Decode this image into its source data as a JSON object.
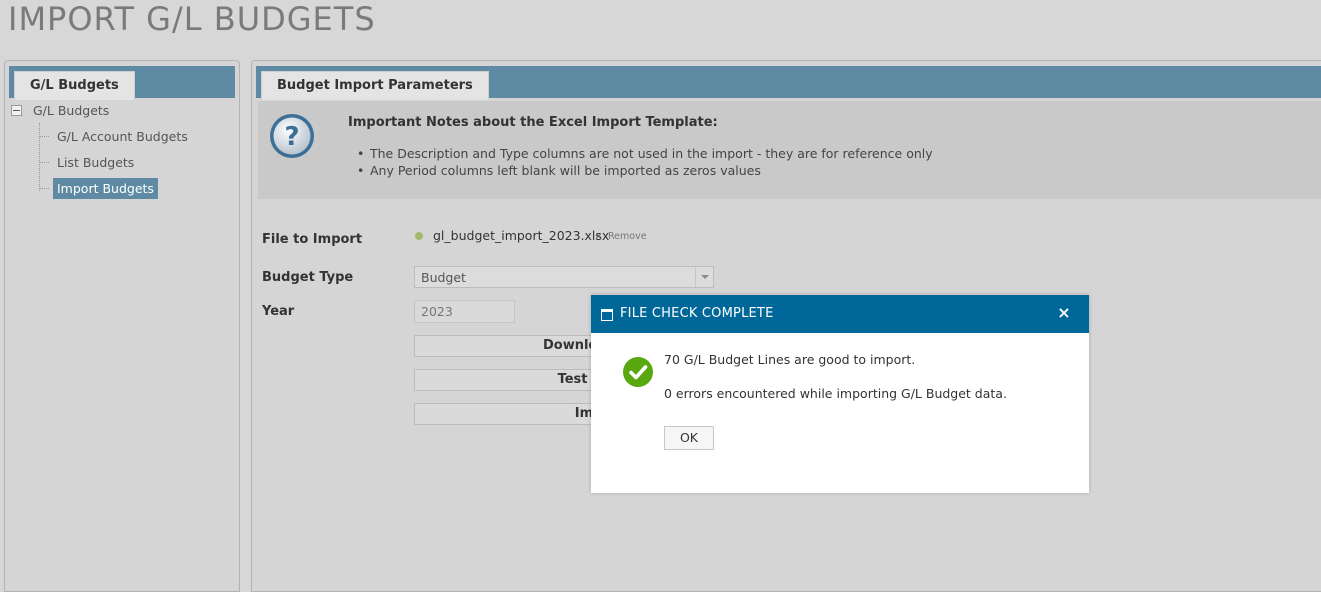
{
  "page": {
    "title": "IMPORT G/L BUDGETS"
  },
  "left_panel": {
    "tab": "G/L Budgets",
    "tree": {
      "root": "G/L Budgets",
      "items": [
        {
          "label": "G/L Account Budgets",
          "selected": false
        },
        {
          "label": "List Budgets",
          "selected": false
        },
        {
          "label": "Import Budgets",
          "selected": true
        }
      ]
    }
  },
  "main_panel": {
    "tab": "Budget Import Parameters",
    "notes": {
      "icon": "help-icon",
      "title": "Important Notes about the Excel Import Template:",
      "items": [
        "The Description and Type columns are not used in the import - they are for reference only",
        "Any Period columns left blank will be imported as zeros values"
      ]
    },
    "form": {
      "file_label": "File to Import",
      "file_name": "gl_budget_import_2023.xlsx",
      "file_remove_x": "×",
      "file_remove": "Remove",
      "budget_type_label": "Budget Type",
      "budget_type_value": "Budget",
      "year_label": "Year",
      "year_value": "2023",
      "buttons": {
        "download": "Download Template",
        "test_import": "Test Import File",
        "import": "Import File"
      }
    }
  },
  "modal": {
    "title": "FILE CHECK COMPLETE",
    "close": "×",
    "line1": "70 G/L Budget Lines are good to import.",
    "line2": "0 errors encountered while importing G/L Budget data.",
    "ok": "OK",
    "colors": {
      "header": "#006799",
      "success": "#5aa80f"
    }
  }
}
